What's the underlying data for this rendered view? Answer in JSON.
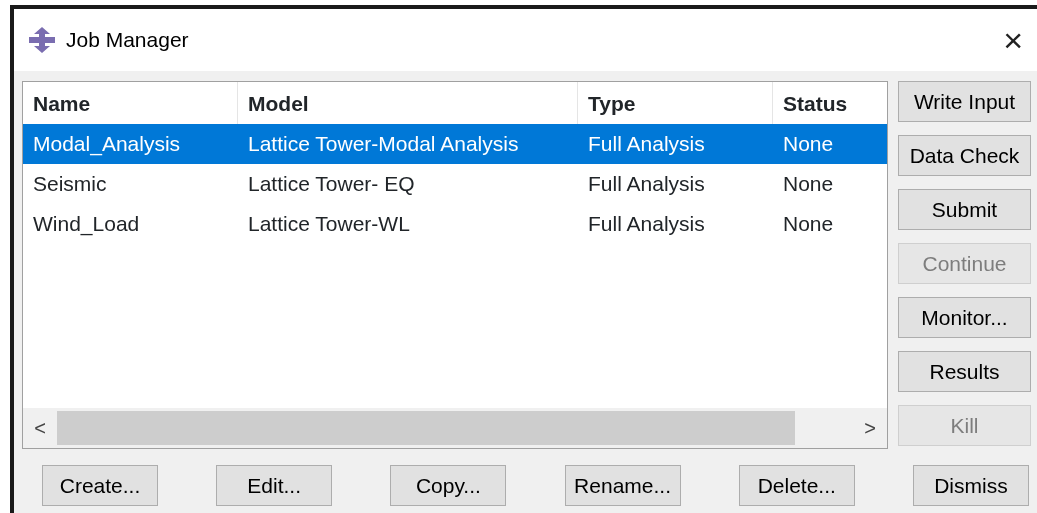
{
  "window": {
    "title": "Job Manager",
    "close": "×"
  },
  "table": {
    "columns": [
      "Name",
      "Model",
      "Type",
      "Status"
    ],
    "rows": [
      {
        "cells": [
          "Modal_Analysis",
          "Lattice Tower-Modal Analysis",
          "Full Analysis",
          "None"
        ],
        "selected": true
      },
      {
        "cells": [
          "Seismic",
          "Lattice Tower- EQ",
          "Full Analysis",
          "None"
        ],
        "selected": false
      },
      {
        "cells": [
          "Wind_Load",
          "Lattice Tower-WL",
          "Full Analysis",
          "None"
        ],
        "selected": false
      }
    ],
    "scroll_left": "<",
    "scroll_right": ">"
  },
  "side_buttons": [
    {
      "label": "Write Input",
      "disabled": false
    },
    {
      "label": "Data Check",
      "disabled": false
    },
    {
      "label": "Submit",
      "disabled": false
    },
    {
      "label": "Continue",
      "disabled": true
    },
    {
      "label": "Monitor...",
      "disabled": false
    },
    {
      "label": "Results",
      "disabled": false
    },
    {
      "label": "Kill",
      "disabled": true
    }
  ],
  "bottom_buttons": [
    "Create...",
    "Edit...",
    "Copy...",
    "Rename...",
    "Delete...",
    "Dismiss"
  ]
}
